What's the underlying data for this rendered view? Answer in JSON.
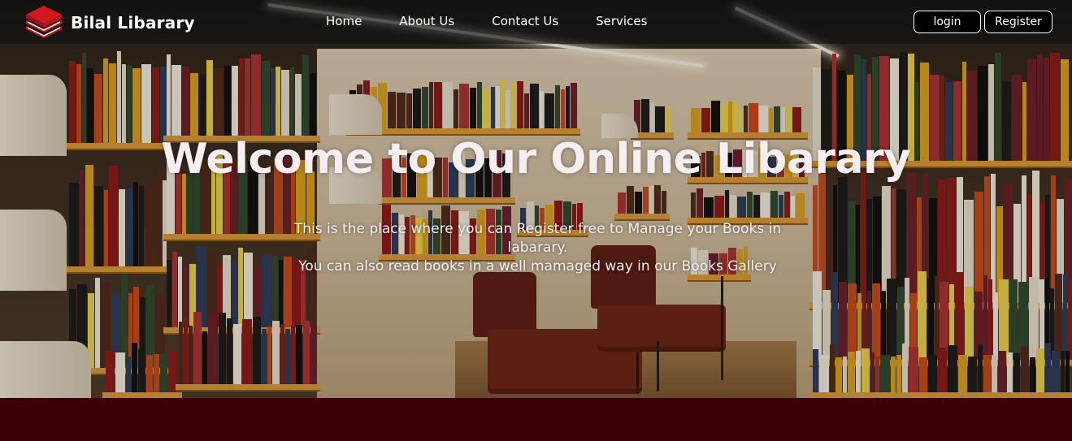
{
  "brand": {
    "name": "Bilal Libarary",
    "logo_icon": "stacked-books-icon"
  },
  "nav": {
    "links": [
      "Home",
      "About Us",
      "Contact Us",
      "Services"
    ]
  },
  "auth": {
    "login_label": "login",
    "register_label": "Register"
  },
  "hero": {
    "title": "Welcome to Our Online Libarary",
    "line1": "This is the place where you can Register free to Manage your Books in labarary.",
    "line2": "You can also read books in a well mamaged way in our Books Gallery"
  },
  "colors": {
    "navbar_bg": "#121212",
    "footer_band": "#3b0006",
    "logo_red": "#c4161c",
    "shelf_wood": "#d89a3a"
  }
}
